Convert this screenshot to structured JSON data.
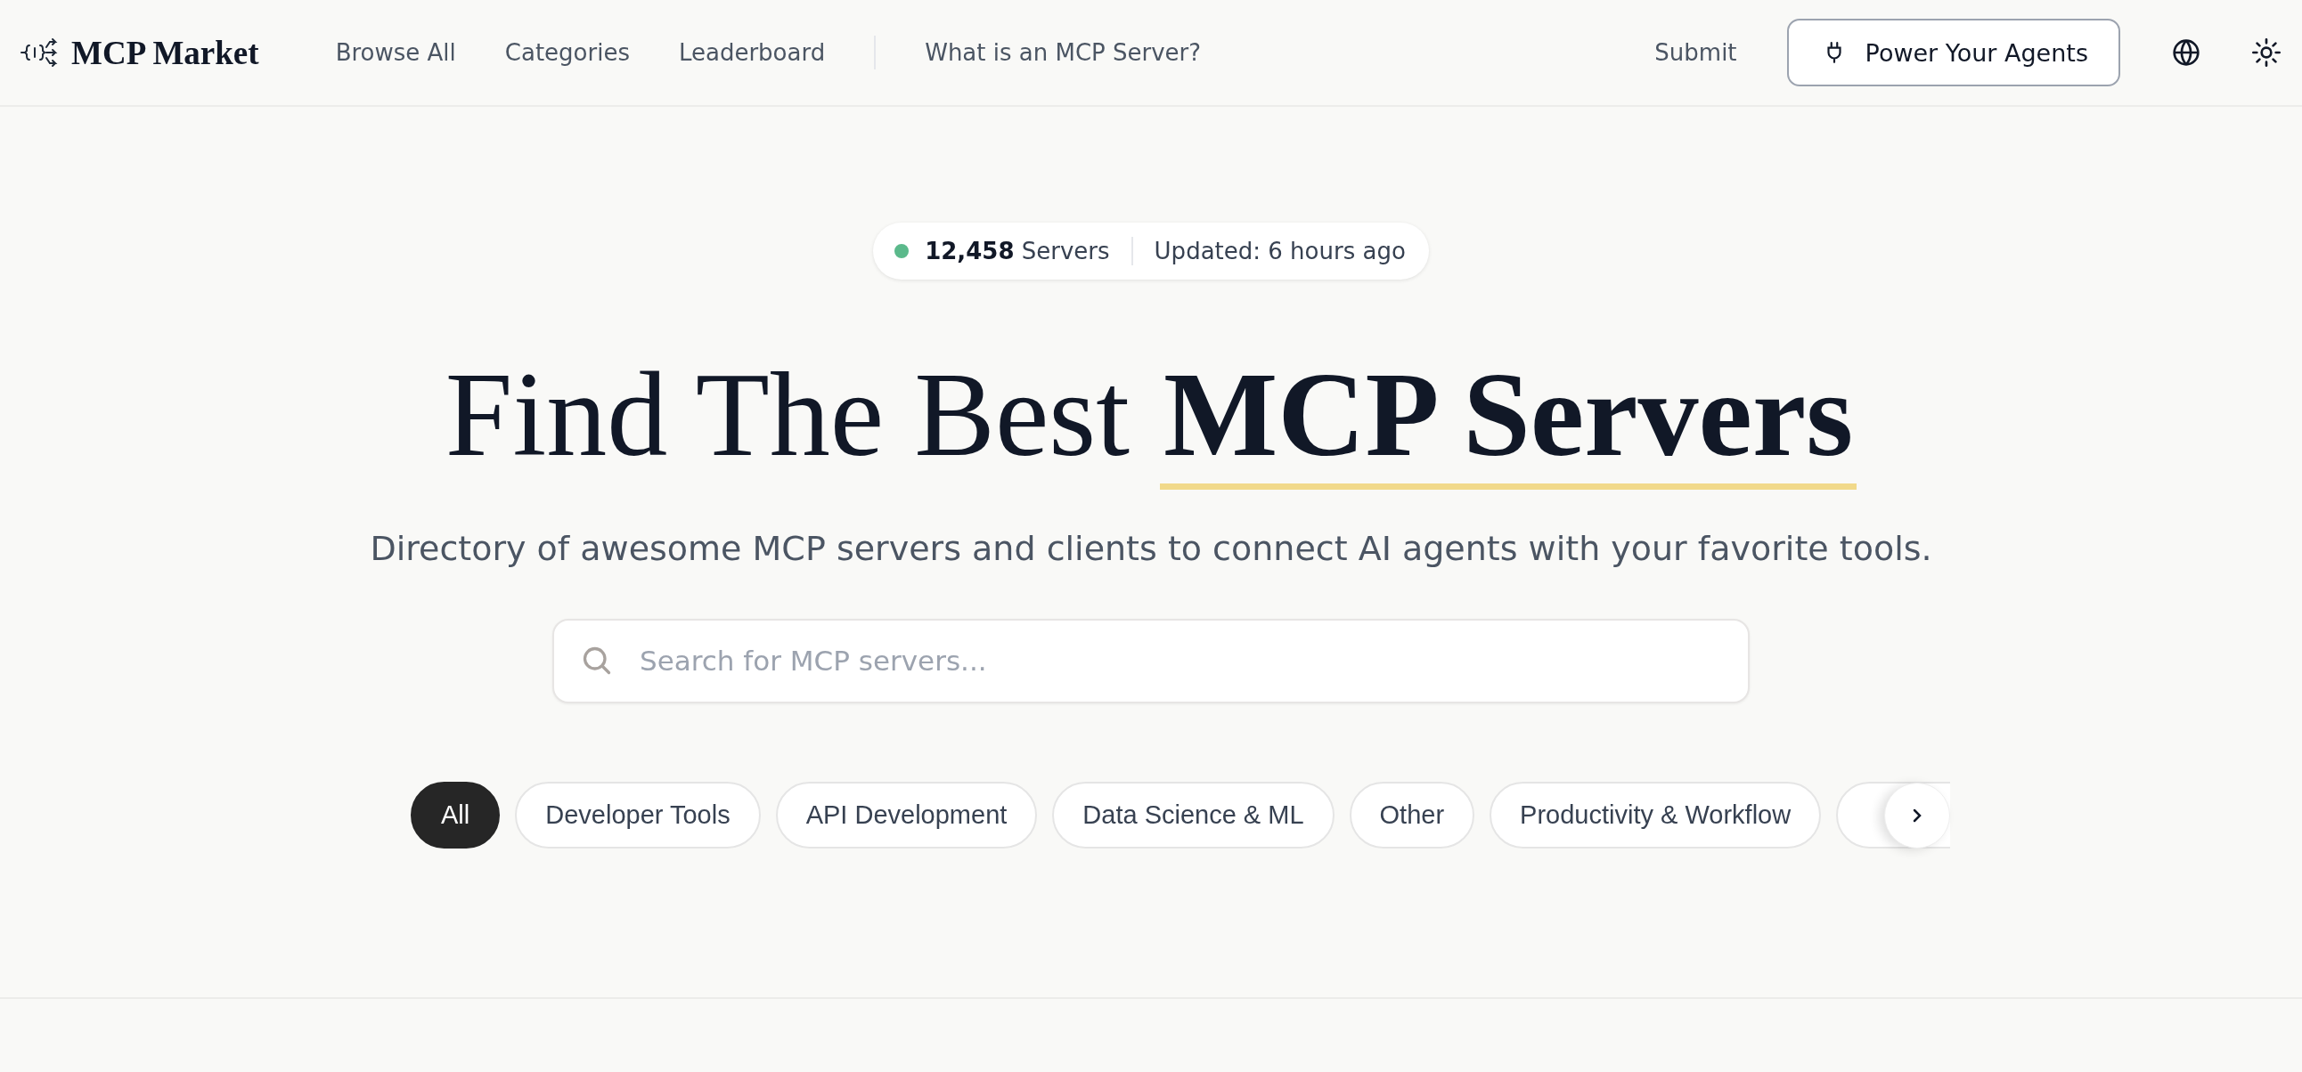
{
  "header": {
    "logo": "MCP Market",
    "nav": [
      {
        "label": "Browse All"
      },
      {
        "label": "Categories"
      },
      {
        "label": "Leaderboard"
      },
      {
        "label": "What is an MCP Server?",
        "separated": true
      }
    ],
    "submit": "Submit",
    "cta": "Power Your Agents"
  },
  "stats": {
    "count": "12,458",
    "count_label": "Servers",
    "updated": "Updated: 6 hours ago"
  },
  "hero": {
    "title": "Find The Best",
    "title_highlight": "MCP Servers",
    "subtitle": "Directory of awesome MCP servers and clients to connect AI agents with your favorite tools."
  },
  "search": {
    "placeholder": "Search for MCP servers..."
  },
  "categories": [
    {
      "label": "All",
      "selected": true
    },
    {
      "label": "Developer Tools",
      "selected": false
    },
    {
      "label": "API Development",
      "selected": false
    },
    {
      "label": "Data Science & ML",
      "selected": false
    },
    {
      "label": "Other",
      "selected": false
    },
    {
      "label": "Productivity & Workflow",
      "selected": false
    }
  ]
}
